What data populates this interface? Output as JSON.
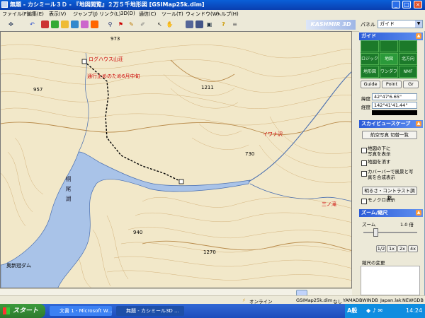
{
  "window": {
    "title": "無題 - カシミール３Ｄ - 『地図閲覧』２万５千地形図 [GSIMap25k.dim]"
  },
  "menu": [
    "ファイル(F)",
    "編集(E)",
    "表示(V)",
    "ジャンプ(J)",
    "リンク(L)",
    "3D(D)",
    "通信(C)",
    "ツール(T)",
    "ウィンドウ(W)",
    "ヘルプ(H)"
  ],
  "toolbar": {
    "brand": "KASHMIR 3D",
    "panel_label": "パネル",
    "panel_value": "ガイド"
  },
  "map": {
    "labels": {
      "peak_973": "973",
      "hut": "ログハウス山荘",
      "road_note": "通行止めのため6月中旬",
      "elev_957": "957",
      "elev_1211": "1211",
      "iwana": "イワナ沢",
      "elev_730": "730",
      "lake": "桐尾湖",
      "elev_940": "940",
      "elev_1270": "1270",
      "dam": "奥新冠ダム",
      "waterfall": "三ノ滝"
    }
  },
  "side": {
    "guide": {
      "header": "ガイド",
      "cells": [
        "",
        "",
        "",
        "ロジック",
        "地図",
        "北方向",
        "地形図",
        "ワンダフル",
        "NMF"
      ],
      "buttons": [
        "Guide",
        "Point",
        "Gr"
      ],
      "lat_label": "緯度",
      "lat_value": "42°47'6.65\"",
      "lon_label": "経度",
      "lon_value": "142°41'41.44\""
    },
    "sky": {
      "header": "スカイビュースケープ",
      "list_button": "航空写真 切替一覧",
      "options": [
        "地図の下に\n写真を表示",
        "地図を消す",
        "カバーバーで風景と写\n真を合成表示"
      ],
      "adjust_button": "明るさ・コントラスト調整",
      "mono": "モノクロ表示"
    },
    "zoom": {
      "header": "ズーム/縮尺",
      "zoom_label": "ズーム",
      "zoom_value": "1.0 倍",
      "scale_buttons": [
        "1/2",
        "1x",
        "2x",
        "4x"
      ],
      "scale_change": "縮尺の変更"
    }
  },
  "status": {
    "online": "オンライン",
    "dim": "GSIMap25k.dim",
    "none": "なし",
    "db": "YAMADBWINDB",
    "region": "Japan.lak",
    "style": "NEWGDB"
  },
  "taskbar": {
    "start": "スタート",
    "task1": "文書 1 - Microsoft W...",
    "task2": "無題 - カシミール3D ...",
    "ime": "A般",
    "time": "14:24"
  },
  "colors": {
    "title": "#0a3fb0",
    "map_bg": "#f2e8c9",
    "water": "#a9c3e8",
    "route": "#000000",
    "annotation": "#cc0000"
  }
}
